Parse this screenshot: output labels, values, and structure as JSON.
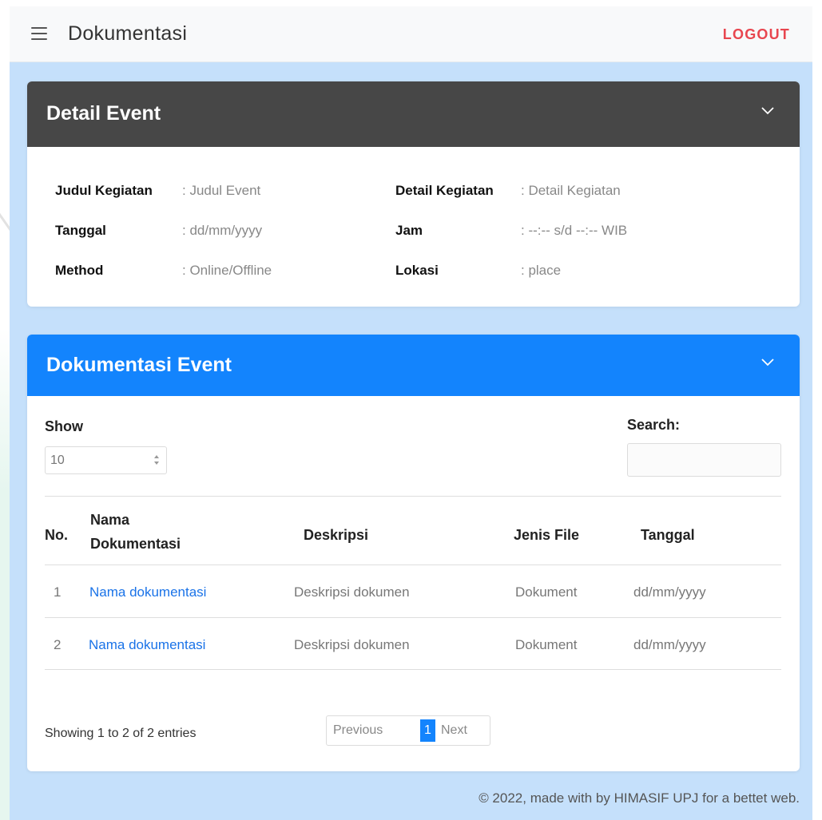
{
  "topbar": {
    "title": "Dokumentasi",
    "logout": "LOGOUT"
  },
  "detail": {
    "title": "Detail Event",
    "fields": [
      {
        "label": "Judul Kegiatan",
        "value": ": Judul Event"
      },
      {
        "label": "Tanggal",
        "value": ": dd/mm/yyyy"
      },
      {
        "label": "Method",
        "value": ": Online/Offline"
      },
      {
        "label": "Detail Kegiatan",
        "value": ": Detail Kegiatan"
      },
      {
        "label": "Jam",
        "value": ": --:-- s/d --:-- WIB"
      },
      {
        "label": "Lokasi",
        "value": ": place"
      }
    ]
  },
  "dokumentasi": {
    "title": "Dokumentasi Event",
    "show_label": "Show",
    "show_value": "10",
    "search_label": "Search:",
    "columns": [
      "No.",
      "Nama",
      "Dokumentasi",
      "Deskripsi",
      "Jenis File",
      "Tanggal"
    ],
    "rows": [
      {
        "no": "1",
        "nama": "Nama dokumentasi",
        "deskripsi": "Deskripsi dokumen",
        "jenis": "Dokument",
        "tanggal": "dd/mm/yyyy"
      },
      {
        "no": "2",
        "nama": "Nama dokumentasi",
        "deskripsi": "Deskripsi dokumen",
        "jenis": "Dokument",
        "tanggal": "dd/mm/yyyy"
      }
    ],
    "info": "Showing 1 to 2 of 2 entries",
    "pagination": {
      "previous": "Previous",
      "current": "1",
      "next": "Next"
    }
  },
  "footer": "© 2022, made with by HIMASIF UPJ for a bettet web."
}
